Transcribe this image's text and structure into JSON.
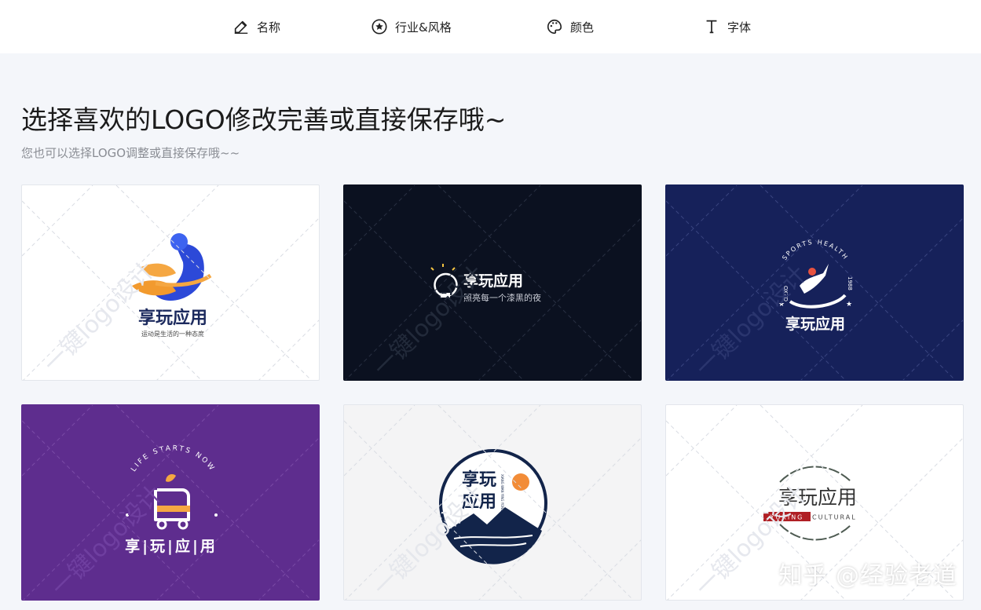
{
  "nav": {
    "items": [
      {
        "label": "名称",
        "icon": "pencil-icon"
      },
      {
        "label": "行业&风格",
        "icon": "star-circle-icon"
      },
      {
        "label": "颜色",
        "icon": "palette-icon"
      },
      {
        "label": "字体",
        "icon": "text-t-icon"
      }
    ]
  },
  "page": {
    "title": "选择喜欢的LOGO修改完善或直接保存哦~",
    "subtitle": "您也可以选择LOGO调整或直接保存哦~~"
  },
  "watermark": {
    "text": "一键logo设计"
  },
  "cards": [
    {
      "bg": "#ffffff",
      "brand": "享玩应用",
      "tagline": "运动是生活的一种态度"
    },
    {
      "bg": "#0b1120",
      "brand": "享玩应用",
      "tagline": "照亮每一个漆黑的夜"
    },
    {
      "bg": "#16215a",
      "brand": "享玩应用",
      "arc_text": "SPORTS HEALTH",
      "left_text": "OXZD",
      "right_text": "1988"
    },
    {
      "bg": "#5e2d8e",
      "brand": "享|玩|应|用",
      "arc_text": "LIFE STARTS NOW"
    },
    {
      "bg": "#f4f4f5",
      "brand_line1": "享玩",
      "brand_line2": "应用",
      "pinyin": "XIANG WAN YING YONG"
    },
    {
      "bg": "#ffffff",
      "brand": "享玩应用",
      "tag_red": "YUXING",
      "tag_text": "CULTURAL"
    }
  ],
  "footer_watermark": "知乎 @经验老道",
  "colors": {
    "accent_orange": "#f5a742",
    "accent_blue": "#3d63f0",
    "dark_navy": "#0b1120",
    "deep_blue": "#16215a",
    "purple": "#5e2d8e",
    "red": "#b01f24",
    "circle_navy": "#12244a"
  }
}
